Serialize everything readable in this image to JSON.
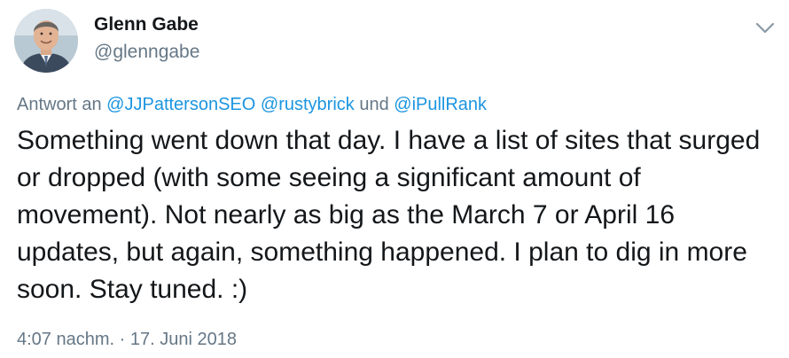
{
  "author": {
    "name": "Glenn Gabe",
    "handle": "@glenngabe"
  },
  "reply": {
    "prefix": "Antwort an",
    "mention_1": "@JJPattersonSEO",
    "mention_2": "@rustybrick",
    "conjunction": "und",
    "mention_3": "@iPullRank"
  },
  "tweet": {
    "text": "Something went down that day. I have a list of sites that surged or dropped (with some seeing a significant amount of movement). Not nearly as big as the March 7 or April 16 updates, but again, something happened. I plan to dig in more soon. Stay tuned. :)",
    "timestamp": "4:07 nachm. · 17. Juni 2018"
  },
  "icons": {
    "menu": "chevron-down-icon",
    "avatar": "profile-photo"
  },
  "colors": {
    "link": "#1b95e0",
    "secondary_text": "#657786",
    "primary_text": "#14171a"
  }
}
